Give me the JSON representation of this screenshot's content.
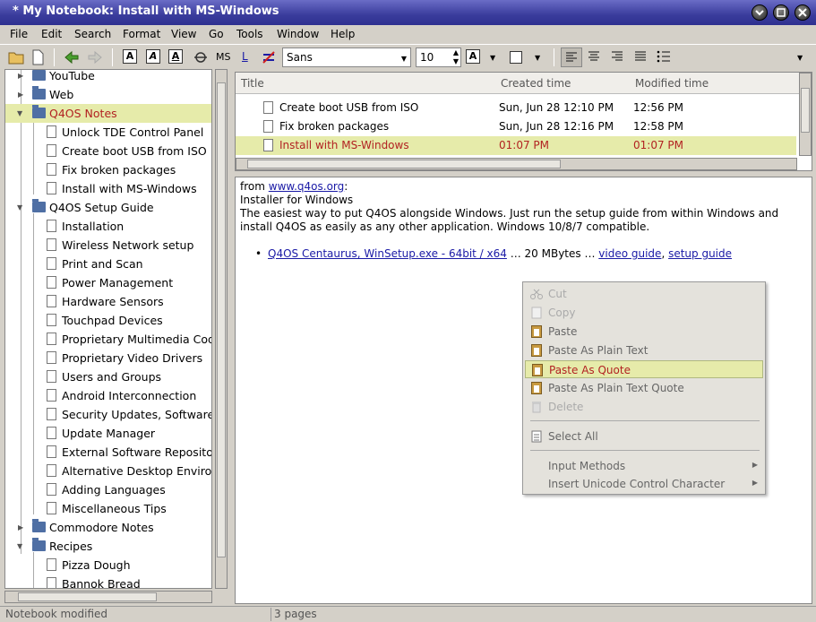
{
  "window": {
    "title": "* My Notebook: Install with MS-Windows"
  },
  "menu": [
    "File",
    "Edit",
    "Search",
    "Format",
    "View",
    "Go",
    "Tools",
    "Window",
    "Help"
  ],
  "toolbar": {
    "font": "Sans",
    "size": "10",
    "ms_label": "MS",
    "l_label": "L"
  },
  "tree": [
    {
      "label": "YouTube",
      "type": "folder",
      "level": 1,
      "expander": "closed"
    },
    {
      "label": "Web",
      "type": "folder",
      "level": 1,
      "expander": "closed"
    },
    {
      "label": "Q4OS Notes",
      "type": "folder",
      "level": 1,
      "expander": "open",
      "selected": true
    },
    {
      "label": "Unlock TDE Control Panel",
      "type": "page",
      "level": 2
    },
    {
      "label": "Create boot USB from ISO",
      "type": "page",
      "level": 2
    },
    {
      "label": "Fix broken packages",
      "type": "page",
      "level": 2
    },
    {
      "label": "Install with MS-Windows",
      "type": "page",
      "level": 2
    },
    {
      "label": "Q4OS Setup Guide",
      "type": "folder",
      "level": 1,
      "expander": "open"
    },
    {
      "label": "Installation",
      "type": "page",
      "level": 2
    },
    {
      "label": "Wireless Network setup",
      "type": "page",
      "level": 2
    },
    {
      "label": "Print and Scan",
      "type": "page",
      "level": 2
    },
    {
      "label": "Power Management",
      "type": "page",
      "level": 2
    },
    {
      "label": "Hardware Sensors",
      "type": "page",
      "level": 2
    },
    {
      "label": "Touchpad Devices",
      "type": "page",
      "level": 2
    },
    {
      "label": "Proprietary Multimedia Code",
      "type": "page",
      "level": 2
    },
    {
      "label": "Proprietary Video Drivers",
      "type": "page",
      "level": 2
    },
    {
      "label": "Users and Groups",
      "type": "page",
      "level": 2
    },
    {
      "label": "Android Interconnection",
      "type": "page",
      "level": 2
    },
    {
      "label": "Security Updates, Software M",
      "type": "page",
      "level": 2
    },
    {
      "label": "Update Manager",
      "type": "page",
      "level": 2
    },
    {
      "label": "External Software Repositori",
      "type": "page",
      "level": 2
    },
    {
      "label": "Alternative Desktop Environn",
      "type": "page",
      "level": 2
    },
    {
      "label": "Adding Languages",
      "type": "page",
      "level": 2
    },
    {
      "label": "Miscellaneous Tips",
      "type": "page",
      "level": 2
    },
    {
      "label": "Commodore Notes",
      "type": "folder",
      "level": 1,
      "expander": "closed"
    },
    {
      "label": "Recipes",
      "type": "folder",
      "level": 1,
      "expander": "open"
    },
    {
      "label": "Pizza Dough",
      "type": "page",
      "level": 2
    },
    {
      "label": "Bannok Bread",
      "type": "page",
      "level": 2
    }
  ],
  "list": {
    "headers": [
      "Title",
      "Created time",
      "Modified time"
    ],
    "rows": [
      {
        "title": "Create boot USB from ISO",
        "created": "Sun, Jun 28 12:10 PM",
        "modified": "12:56 PM"
      },
      {
        "title": "Fix broken packages",
        "created": "Sun, Jun 28 12:16 PM",
        "modified": "12:58 PM"
      },
      {
        "title": "Install with MS-Windows",
        "created": "01:07 PM",
        "modified": "01:07 PM",
        "selected": true
      }
    ]
  },
  "editor": {
    "from_prefix": "from ",
    "from_link": "www.q4os.org",
    "from_suffix": ":",
    "line2": "Installer for Windows",
    "para": " The easiest way to put Q4OS alongside Windows. Just run the setup guide from within Windows and install Q4OS as easily as any other application. Windows 10/8/7 compatible.",
    "bullet_link": "Q4OS Centaurus, WinSetup.exe - 64bit / x64",
    "bullet_mid": " … 20 MBytes … ",
    "video_link": "video guide",
    "comma": ", ",
    "setup_link": "setup guide"
  },
  "context_menu": [
    {
      "label": "Cut",
      "disabled": true
    },
    {
      "label": "Copy",
      "disabled": true
    },
    {
      "label": "Paste"
    },
    {
      "label": "Paste As Plain Text"
    },
    {
      "label": "Paste As Quote",
      "highlighted": true
    },
    {
      "label": "Paste As Plain Text Quote"
    },
    {
      "label": "Delete",
      "disabled": true
    },
    {
      "label": "Select All"
    },
    {
      "label": "Input Methods",
      "submenu": true
    },
    {
      "label": "Insert Unicode Control Character",
      "submenu": true
    }
  ],
  "status": {
    "left": "Notebook modified",
    "right": "3 pages"
  }
}
